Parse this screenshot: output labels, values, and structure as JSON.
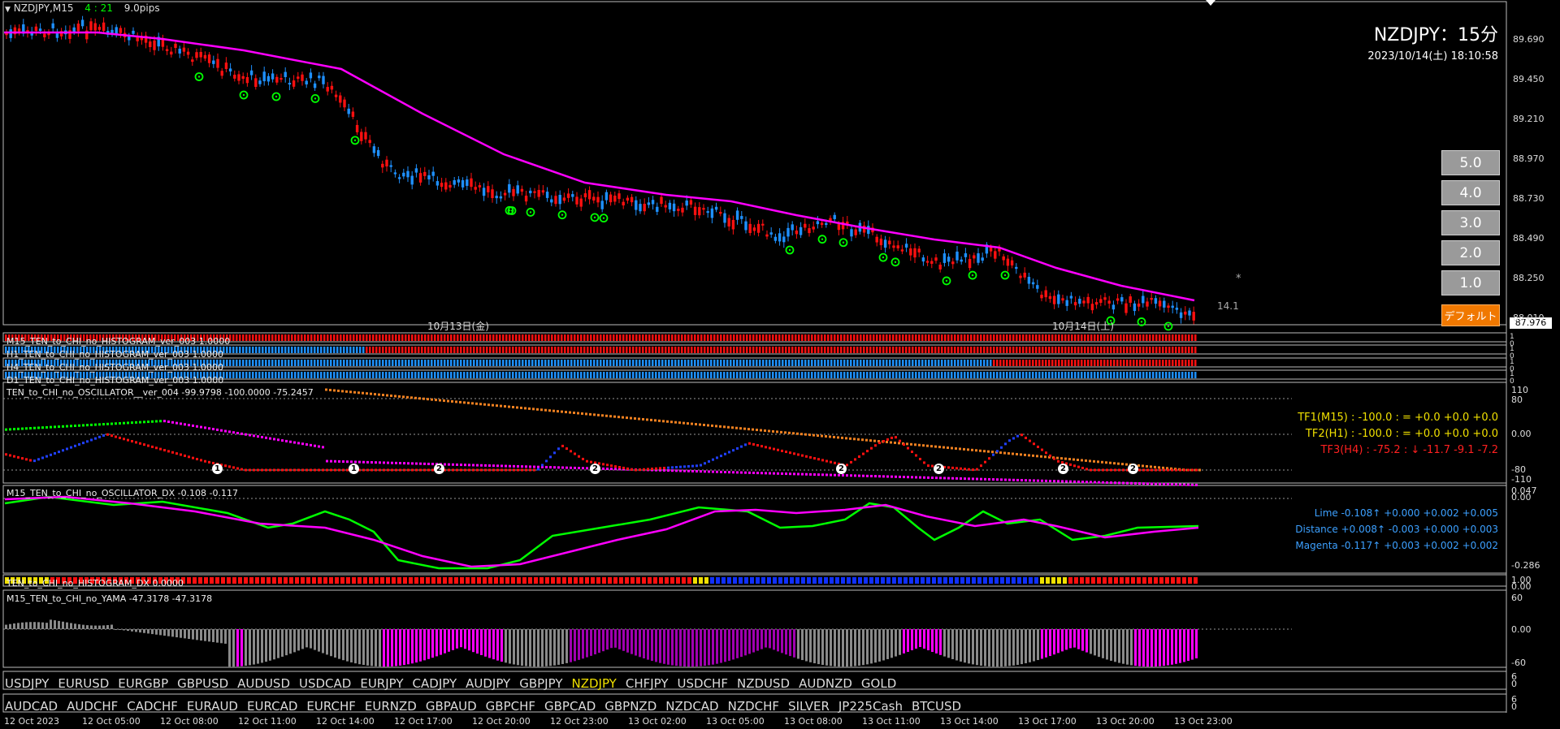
{
  "chart_header": {
    "symbol": "NZDJPY,M15",
    "countdown": "4 : 21",
    "spread": "9.0pips"
  },
  "title": "NZDJPY：15分",
  "datetime": "2023/10/14(土) 18:10:58",
  "price_axis": [
    "89.690",
    "89.450",
    "89.210",
    "88.970",
    "88.730",
    "88.490",
    "88.250",
    "88.010"
  ],
  "current_price": "87.976",
  "price_marker": "14.1",
  "star_marker": "*",
  "date_markers": [
    "10月13日(金)",
    "10月14日(土)"
  ],
  "buttons": [
    "5.0",
    "4.0",
    "3.0",
    "2.0",
    "1.0"
  ],
  "default_button": "デフォルト",
  "histograms": [
    {
      "label": "M15_TEN_to_CHI_no_HISTOGRAM_ver_003 1.0000",
      "scale": [
        "1",
        "0"
      ]
    },
    {
      "label": "H1_TEN_to_CHI_no_HISTOGRAM_ver_003 1.0000",
      "scale": [
        "1",
        "0"
      ]
    },
    {
      "label": "H4_TEN_to_CHI_no_HISTOGRAM_ver_003 1.0000",
      "scale": [
        "1",
        "0"
      ]
    },
    {
      "label": "D1_TEN_to_CHI_no_HISTOGRAM_ver_003 1.0000",
      "scale": [
        "1",
        "0"
      ]
    }
  ],
  "oscillator": {
    "label": "TEN_to_CHI_no_OSCILLATOR__ver_004 -99.9798 -100.0000 -75.2457",
    "scale": [
      "110",
      "80",
      "0.00",
      "-80",
      "-110"
    ],
    "tf": [
      {
        "text": "TF1(M15) : -100.0 : = +0.0 +0.0 +0.0",
        "color": "#f0e000"
      },
      {
        "text": "TF2(H1) : -100.0 : = +0.0 +0.0 +0.0",
        "color": "#f0e000"
      },
      {
        "text": "TF3(H4) : -75.2 : ↓  -11.7 -9.1 -7.2",
        "color": "#ff2020"
      }
    ],
    "markers": [
      "1",
      "1",
      "2",
      "2",
      "2",
      "2",
      "2",
      "2"
    ]
  },
  "osc_dx": {
    "label": "M15_TEN_to_CHI_no_OSCILLATOR_DX -0.108 -0.117",
    "scale": [
      "0.047",
      "0.00",
      "-0.286"
    ],
    "lines": [
      {
        "text": "Lime -0.108↑  +0.000 +0.002 +0.005"
      },
      {
        "text": "Distance +0.008↑  -0.003 +0.000 +0.003"
      },
      {
        "text": "Magenta -0.117↑  +0.003 +0.002 +0.002"
      }
    ]
  },
  "hist_dx": {
    "label": "TEN_to_CHI_no_HISTOGRAM_DX 0.0000",
    "scale": [
      "1.00",
      "0.00"
    ]
  },
  "yama": {
    "label": "M15_TEN_to_CHI_no_YAMA -47.3178 -47.3178",
    "scale": [
      "60",
      "0.00",
      "-60"
    ]
  },
  "symbols_row1": [
    "USDJPY",
    "EURUSD",
    "EURGBP",
    "GBPUSD",
    "AUDUSD",
    "USDCAD",
    "EURJPY",
    "CADJPY",
    "AUDJPY",
    "GBPJPY",
    "NZDJPY",
    "CHFJPY",
    "USDCHF",
    "NZDUSD",
    "AUDNZD",
    "GOLD"
  ],
  "symbols_row1_active": "NZDJPY",
  "symbols_row2": [
    "AUDCAD",
    "AUDCHF",
    "CADCHF",
    "EURAUD",
    "EURCAD",
    "EURCHF",
    "EURNZD",
    "GBPAUD",
    "GBPCHF",
    "GBPCAD",
    "GBPNZD",
    "NZDCAD",
    "NZDCHF",
    "SILVER",
    "JP225Cash",
    "BTCUSD"
  ],
  "row_scales": {
    "row1": [
      "6",
      "0"
    ],
    "row2": [
      "6",
      "0"
    ]
  },
  "time_axis": [
    "12 Oct 2023",
    "12 Oct 05:00",
    "12 Oct 08:00",
    "12 Oct 11:00",
    "12 Oct 14:00",
    "12 Oct 17:00",
    "12 Oct 20:00",
    "12 Oct 23:00",
    "13 Oct 02:00",
    "13 Oct 05:00",
    "13 Oct 08:00",
    "13 Oct 11:00",
    "13 Oct 14:00",
    "13 Oct 17:00",
    "13 Oct 20:00",
    "13 Oct 23:00"
  ],
  "colors": {
    "bull": "#1e90ff",
    "bear": "#ff1010",
    "ma": "#ff00ff",
    "lime": "#00ff00",
    "accent_orange": "#f07800",
    "active_symbol": "#f0e000"
  }
}
